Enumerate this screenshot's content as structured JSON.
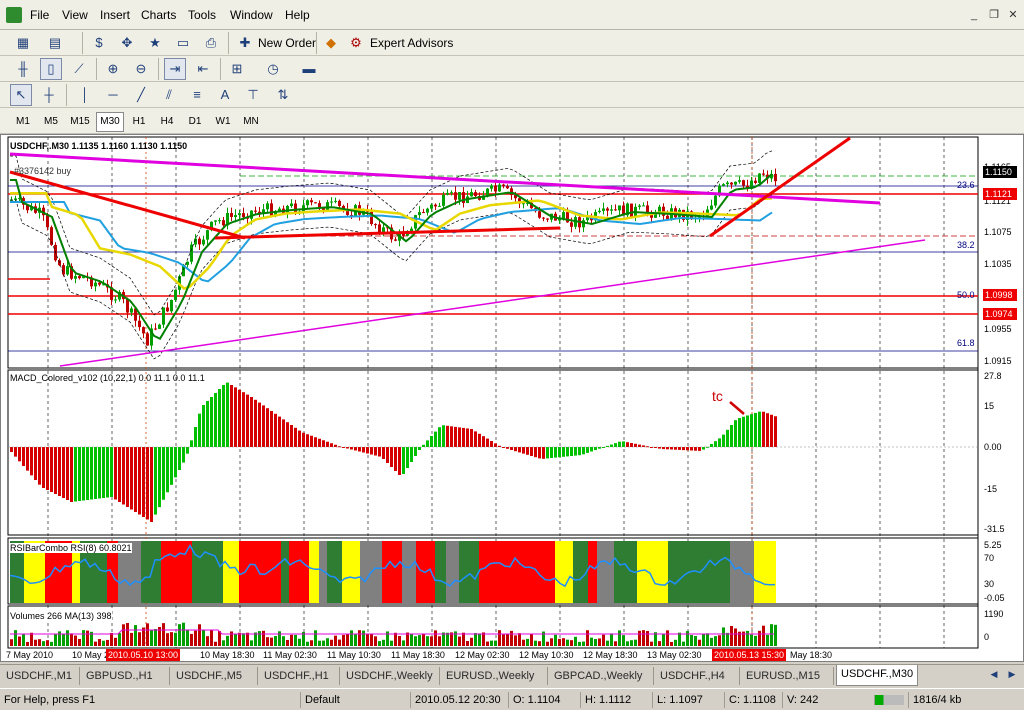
{
  "menu": {
    "items": [
      "File",
      "View",
      "Insert",
      "Charts",
      "Tools",
      "Window",
      "Help"
    ]
  },
  "toolbar1": {
    "new_order": "New Order",
    "expert_advisors": "Expert Advisors"
  },
  "toolbar3": {
    "text_tool": "A"
  },
  "timeframes": [
    "M1",
    "M5",
    "M15",
    "M30",
    "H1",
    "H4",
    "D1",
    "W1",
    "MN"
  ],
  "active_timeframe": "M30",
  "chart": {
    "header": "USDCHF,.M30  1.1135 1.1160 1.1130 1.1150",
    "order_label": "#3376142 buy",
    "current_price": "1.1150",
    "price_tags": [
      "1.1121",
      "1.0998",
      "1.0974"
    ],
    "axis_labels": [
      "1.1165",
      "1.1121",
      "1.1075",
      "1.1035",
      "1.0998",
      "1.0955",
      "1.0915"
    ],
    "fib_labels": [
      "23.6",
      "38.2",
      "50.0",
      "61.8"
    ],
    "macd": {
      "title": "MACD_Colored_v102 (10,22,1) 0.0 11.1 0.0 11.1",
      "axis": [
        "27.8",
        "15",
        "0.00",
        "-15",
        "-31.5"
      ],
      "annotation": "tc"
    },
    "rsi": {
      "title": "RSIBarCombo  RSI(8) 60.8021",
      "axis": [
        "5.25",
        "70",
        "30",
        "-0.05"
      ]
    },
    "volume": {
      "title": "Volumes 266  MA(13) 398",
      "axis": [
        "1190",
        "0"
      ]
    },
    "time_labels": [
      "7 May 2010",
      "10 May 20",
      "10 May 18:30",
      "11 May 02:30",
      "11 May 10:30",
      "11 May 18:30",
      "12 May 02:30",
      "12 May 10:30",
      "12 May 18:30",
      "13 May 02:30",
      "May 18:30"
    ],
    "time_tags": [
      "2010.05.10 13:00",
      "2010.05.13 15:30"
    ]
  },
  "tabs": [
    "USDCHF.,M1",
    "GBPUSD.,H1",
    "USDCHF.,M5",
    "USDCHF.,H1",
    "USDCHF.,Weekly",
    "EURUSD.,Weekly",
    "GBPCAD.,Weekly",
    "USDCHF.,H4",
    "EURUSD.,M15",
    "USDCHF.,M30"
  ],
  "active_tab": "USDCHF.,M30",
  "status": {
    "help": "For Help, press F1",
    "profile": "Default",
    "datetime": "2010.05.12 20:30",
    "open": "O: 1.1104",
    "high": "H: 1.1112",
    "low": "L: 1.1097",
    "close": "C: 1.1108",
    "volume": "V: 242",
    "traffic": "1816/4 kb"
  },
  "colors": {
    "bull": "#00c000",
    "bear": "#d40000",
    "trendline": "#e000e0",
    "rsi_line": "#1e90ff",
    "sma_green": "#008000",
    "sma_yellow": "#e8d800",
    "sma_blue": "#20a0e0"
  }
}
